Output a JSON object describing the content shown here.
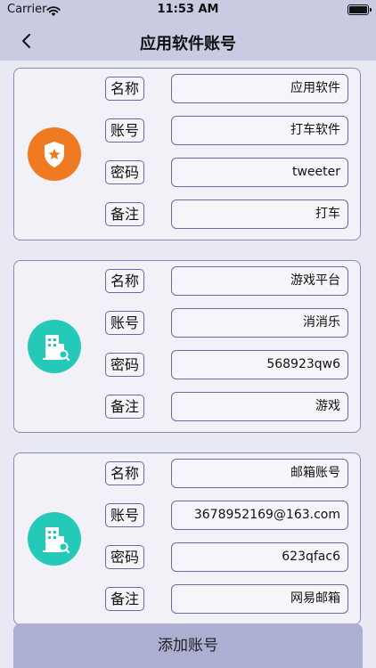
{
  "status_bar": {
    "carrier": "Carrier",
    "time": "11:53 AM"
  },
  "nav": {
    "title": "应用软件账号"
  },
  "labels": {
    "name": "名称",
    "account": "账号",
    "password": "密码",
    "note": "备注"
  },
  "accounts": [
    {
      "icon": "shield-star-icon",
      "icon_color": "#f07a22",
      "name": "应用软件",
      "account": "打车软件",
      "password": "tweeter",
      "note": "打车"
    },
    {
      "icon": "building-search-icon",
      "icon_color": "#25c9b8",
      "name": "游戏平台",
      "account": "消消乐",
      "password": "568923qw6",
      "note": "游戏"
    },
    {
      "icon": "building-search-icon",
      "icon_color": "#25c9b8",
      "name": "邮箱账号",
      "account": "3678952169@163.com",
      "password": "623qfac6",
      "note": "网易邮箱"
    }
  ],
  "add_button": {
    "label": "添加账号"
  },
  "colors": {
    "nav_bg": "#c9cbe3",
    "page_bg": "#e9e9f4",
    "card_border": "#8a8ab8",
    "button_bg": "#acaed2"
  }
}
